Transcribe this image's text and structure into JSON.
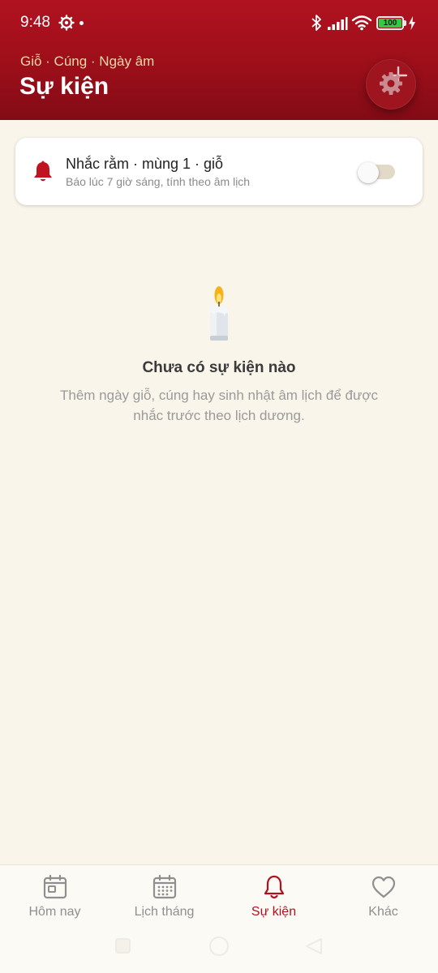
{
  "status_bar": {
    "time": "9:48",
    "battery": "100"
  },
  "header": {
    "subtitle": "Giỗ · Cúng · Ngày âm",
    "title": "Sự kiện",
    "fab_icon": "add-icon",
    "settings_icon": "gear-icon"
  },
  "reminder": {
    "title": "Nhắc rằm · mùng 1 · giỗ",
    "subtitle": "Báo lúc 7 giờ sáng, tính theo âm lịch",
    "enabled": false
  },
  "empty_state": {
    "icon": "candle-icon",
    "title": "Chưa có sự kiện nào",
    "description": "Thêm ngày giỗ, cúng hay sinh nhật âm lịch để được nhắc trước theo lịch dương."
  },
  "nav": {
    "items": [
      {
        "label": "Hôm nay",
        "icon": "today-icon"
      },
      {
        "label": "Lịch tháng",
        "icon": "calendar-grid-icon"
      },
      {
        "label": "Sự kiện",
        "icon": "bell-icon"
      },
      {
        "label": "Khác",
        "icon": "heart-icon"
      }
    ],
    "active": "Sự kiện"
  },
  "colors": {
    "primary": "#b1121f",
    "accent_gold": "#f3d6a8",
    "background": "#faf5ea",
    "inactive": "#8f8f8f"
  }
}
